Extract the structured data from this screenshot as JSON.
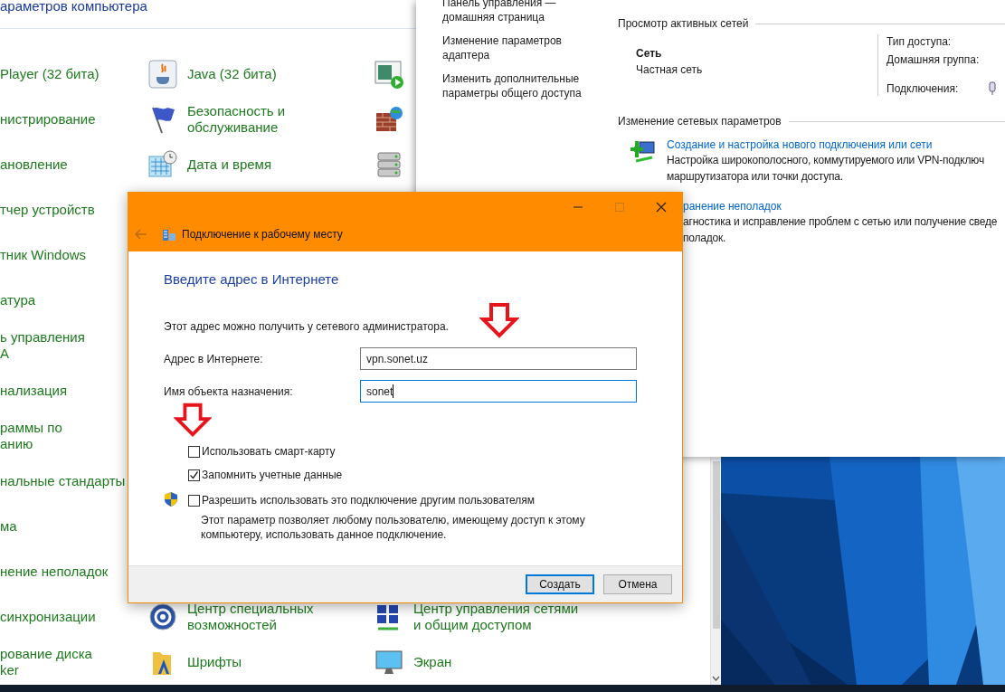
{
  "control_panel": {
    "header": "араметров компьютера",
    "rows": [
      {
        "kind": "full",
        "column_1": "Player (32 бита)",
        "column_2": "Java (32 бита)"
      },
      {
        "kind": "full",
        "column_1": "нистрирование",
        "column_2": "Безопасность и\nобслуживание"
      },
      {
        "kind": "full",
        "column_1": "ановление",
        "column_2": "Дата и время"
      },
      {
        "kind": "covered",
        "column_1": "тчер устройств"
      },
      {
        "kind": "covered",
        "column_1": "тник Windows"
      },
      {
        "kind": "covered",
        "column_1": "атура"
      },
      {
        "kind": "covered",
        "column_1": "ь управления\nА"
      },
      {
        "kind": "covered",
        "column_1": "нализация"
      },
      {
        "kind": "covered",
        "column_1": "раммы по\nанию"
      },
      {
        "kind": "covered",
        "column_1": "нальные стандарты"
      },
      {
        "kind": "covered",
        "column_1": "ма"
      },
      {
        "kind": "covered",
        "column_1": "нение неполадок"
      },
      {
        "kind": "full",
        "column_1": "синхронизации",
        "column_2": "Центр специальных\nвозможностей",
        "column_3": "Центр управления сетями\nи общим доступом"
      },
      {
        "kind": "full",
        "column_1": "рование диска\nker",
        "column_2": "Шрифты",
        "column_3": "Экран"
      }
    ]
  },
  "network_window": {
    "left_links": [
      "Панель управления —\nдомашняя страница",
      "Изменение параметров\nадаптера",
      "Изменить дополнительные\nпараметры общего доступа"
    ],
    "active_networks": {
      "heading": "Просмотр активных сетей",
      "network_name": "Сеть",
      "network_type": "Частная сеть",
      "fields": [
        "Тип доступа:",
        "Домашняя группа:",
        "Подключения:"
      ]
    },
    "change_settings": {
      "heading": "Изменение сетевых параметров",
      "tasks": [
        {
          "kind": "full",
          "link": "Создание и настройка нового подключения или сети",
          "description": "Настройка широкополосного, коммутируемого или VPN-подключ\nмаршрутизатора или точки доступа."
        },
        {
          "kind": "covered",
          "link": "ранение неполадок",
          "description": "агностика и исправление проблем с сетью или получение сведе\nполадок."
        }
      ]
    }
  },
  "dialog": {
    "title": "Подключение к рабочему месту",
    "maximize_enabled": false,
    "heading": "Введите адрес в Интернете",
    "hint": "Этот адрес можно получить у сетевого администратора.",
    "fields": [
      {
        "label": "Адрес в Интернете:",
        "value": "vpn.sonet.uz",
        "focused": false
      },
      {
        "label": "Имя объекта назначения:",
        "value": "sonet",
        "focused": true
      }
    ],
    "options": [
      {
        "kind": "plain",
        "label": "Использовать смарт-карту",
        "checked": false
      },
      {
        "kind": "plain",
        "label": "Запомнить учетные данные",
        "checked": true
      },
      {
        "kind": "admin",
        "label": "Разрешить использовать это подключение другим пользователям",
        "checked": false,
        "description": "Этот параметр позволяет любому пользователю, имеющему доступ к этому компьютеру, использовать данное подключение."
      }
    ],
    "buttons": [
      {
        "label": "Создать",
        "default": true
      },
      {
        "label": "Отмена",
        "default": false
      }
    ]
  }
}
